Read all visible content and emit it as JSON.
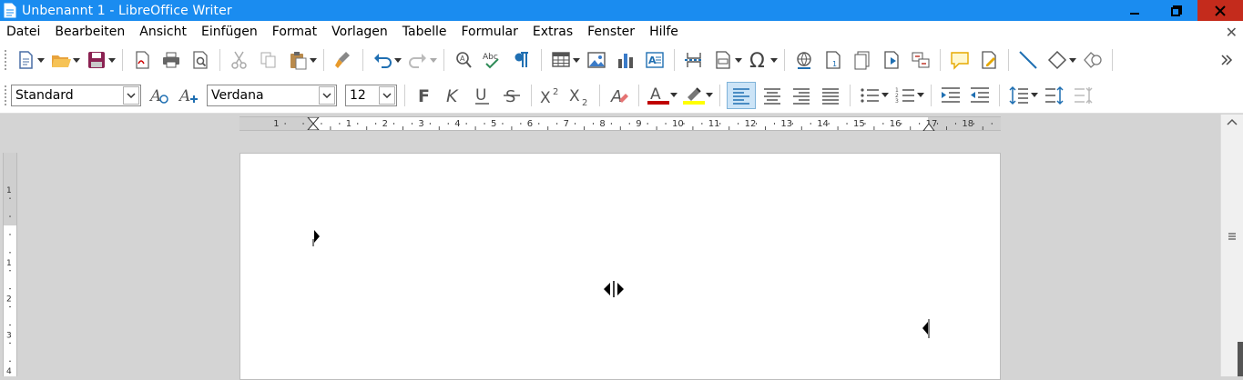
{
  "window": {
    "title": "Unbenannt 1 - LibreOffice Writer"
  },
  "menubar": {
    "items": [
      {
        "label": "Datei"
      },
      {
        "label": "Bearbeiten"
      },
      {
        "label": "Ansicht"
      },
      {
        "label": "Einfügen"
      },
      {
        "label": "Format"
      },
      {
        "label": "Vorlagen"
      },
      {
        "label": "Tabelle"
      },
      {
        "label": "Formular"
      },
      {
        "label": "Extras"
      },
      {
        "label": "Fenster"
      },
      {
        "label": "Hilfe"
      }
    ]
  },
  "formatting": {
    "paragraph_style": "Standard",
    "font_name": "Verdana",
    "font_size": "12"
  },
  "ruler": {
    "h_labels": [
      "1",
      "1",
      "2",
      "3",
      "4",
      "5",
      "6",
      "7",
      "8",
      "9",
      "10",
      "11",
      "12",
      "13",
      "14",
      "15",
      "16",
      "17",
      "18"
    ],
    "v_labels": [
      "1",
      "1",
      "2",
      "3",
      "4"
    ]
  },
  "colors": {
    "titlebar": "#1a8cf0",
    "close_button": "#c42b1c",
    "font_color_bar": "#c00000",
    "highlight_bar": "#ffff00",
    "accent_icon": "#1f6fb2"
  }
}
